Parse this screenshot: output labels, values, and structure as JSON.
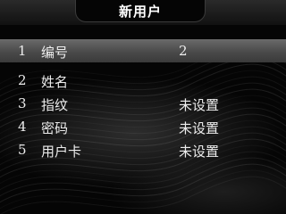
{
  "title": "新用户",
  "menu": {
    "items": [
      {
        "index": "1",
        "label": "编号",
        "value": "2",
        "selected": true
      },
      {
        "index": "2",
        "label": "姓名",
        "value": "",
        "selected": false
      },
      {
        "index": "3",
        "label": "指纹",
        "value": "未设置",
        "selected": false
      },
      {
        "index": "4",
        "label": "密码",
        "value": "未设置",
        "selected": false
      },
      {
        "index": "5",
        "label": "用户卡",
        "value": "未设置",
        "selected": false
      }
    ]
  },
  "colors": {
    "background": "#050505",
    "selected_row": "#5a5a5a",
    "text": "#ededed"
  }
}
